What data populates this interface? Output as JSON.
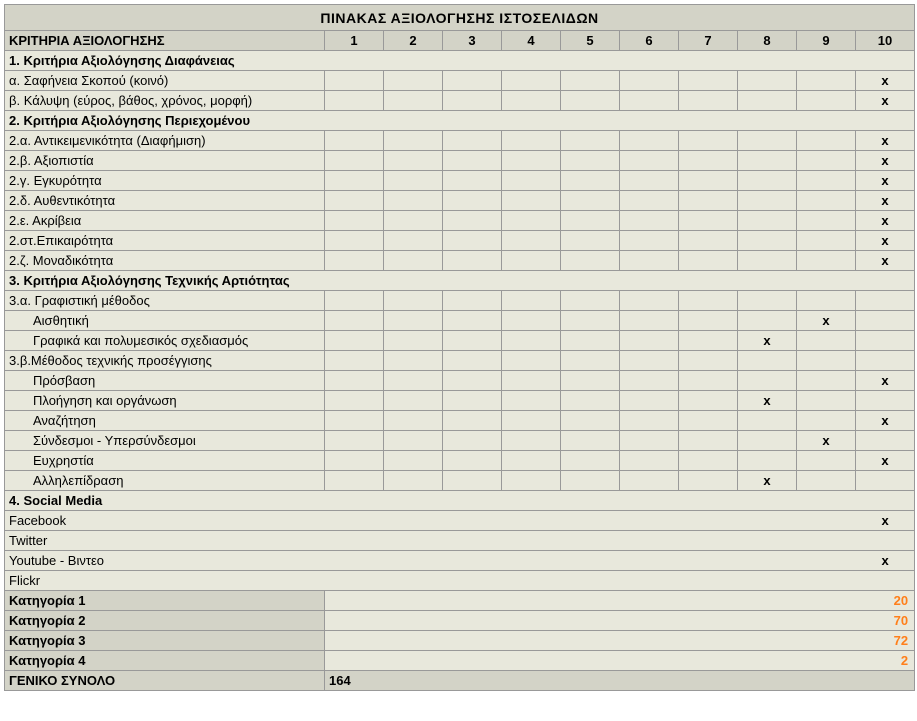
{
  "title": "ΠΙΝΑΚΑΣ ΑΞΙΟΛΟΓΗΣΗΣ ΙΣΤΟΣΕΛΙΔΩΝ",
  "criteria_header": "ΚΡΙΤΗΡΙΑ ΑΞΙΟΛΟΓΗΣΗΣ",
  "columns": [
    "1",
    "2",
    "3",
    "4",
    "5",
    "6",
    "7",
    "8",
    "9",
    "10"
  ],
  "mark": "x",
  "rows": [
    {
      "type": "section",
      "label": "1. Κριτήρια Αξιολόγησης Διαφάνειας"
    },
    {
      "type": "item",
      "label": "α. Σαφήνεια Σκοπού (κοινό)",
      "score": 10
    },
    {
      "type": "item",
      "label": "β. Κάλυψη (εύρος, βάθος, χρόνος, μορφή)",
      "score": 10
    },
    {
      "type": "section",
      "label": "2. Κριτήρια Αξιολόγησης Περιεχομένου"
    },
    {
      "type": "item",
      "label": "2.α. Αντικειμενικότητα (Διαφήμιση)",
      "score": 10
    },
    {
      "type": "item",
      "label": "2.β. Αξιοπιστία",
      "score": 10
    },
    {
      "type": "item",
      "label": "2.γ. Εγκυρότητα",
      "score": 10
    },
    {
      "type": "item",
      "label": "2.δ. Αυθεντικότητα",
      "score": 10
    },
    {
      "type": "item",
      "label": "2.ε. Ακρίβεια",
      "score": 10
    },
    {
      "type": "item",
      "label": "2.στ.Επικαιρότητα",
      "score": 10
    },
    {
      "type": "item",
      "label": "2.ζ. Μοναδικότητα",
      "score": 10
    },
    {
      "type": "section",
      "label": "3. Κριτήρια Αξιολόγησης Τεχνικής Αρτιότητας"
    },
    {
      "type": "item",
      "label": "3.α. Γραφιστική μέθοδος",
      "score": null
    },
    {
      "type": "item",
      "label": "Αισθητική",
      "indent": true,
      "score": 9
    },
    {
      "type": "item",
      "label": "Γραφικά και πολυμεσικός σχεδιασμός",
      "indent": true,
      "score": 8
    },
    {
      "type": "item",
      "label": "3.β.Μέθοδος τεχνικής προσέγγισης",
      "score": null
    },
    {
      "type": "item",
      "label": "Πρόσβαση",
      "indent": true,
      "score": 10
    },
    {
      "type": "item",
      "label": "Πλοήγηση και οργάνωση",
      "indent": true,
      "score": 8
    },
    {
      "type": "item",
      "label": "Αναζήτηση",
      "indent": true,
      "score": 10
    },
    {
      "type": "item",
      "label": "Σύνδεσμοι - Υπερσύνδεσμοι",
      "indent": true,
      "score": 9
    },
    {
      "type": "item",
      "label": "Ευχρηστία",
      "indent": true,
      "score": 10
    },
    {
      "type": "item",
      "label": "Αλληλεπίδραση",
      "indent": true,
      "score": 8
    },
    {
      "type": "section",
      "label": "4. Social Media"
    },
    {
      "type": "wide",
      "label": "Facebook",
      "mark_col": 10
    },
    {
      "type": "wide",
      "label": "Twitter",
      "mark_col": null
    },
    {
      "type": "wide",
      "label": "Youtube - Βιντεο",
      "mark_col": 10
    },
    {
      "type": "wide",
      "label": "Flickr",
      "mark_col": null
    }
  ],
  "categories": [
    {
      "label": "Κατηγορία 1",
      "value": "20"
    },
    {
      "label": "Κατηγορία 2",
      "value": "70"
    },
    {
      "label": "Κατηγορία 3",
      "value": "72"
    },
    {
      "label": "Κατηγορία 4",
      "value": "2"
    }
  ],
  "total": {
    "label": "ΓΕΝΙΚΟ ΣΥΝΟΛΟ",
    "value": "164"
  }
}
